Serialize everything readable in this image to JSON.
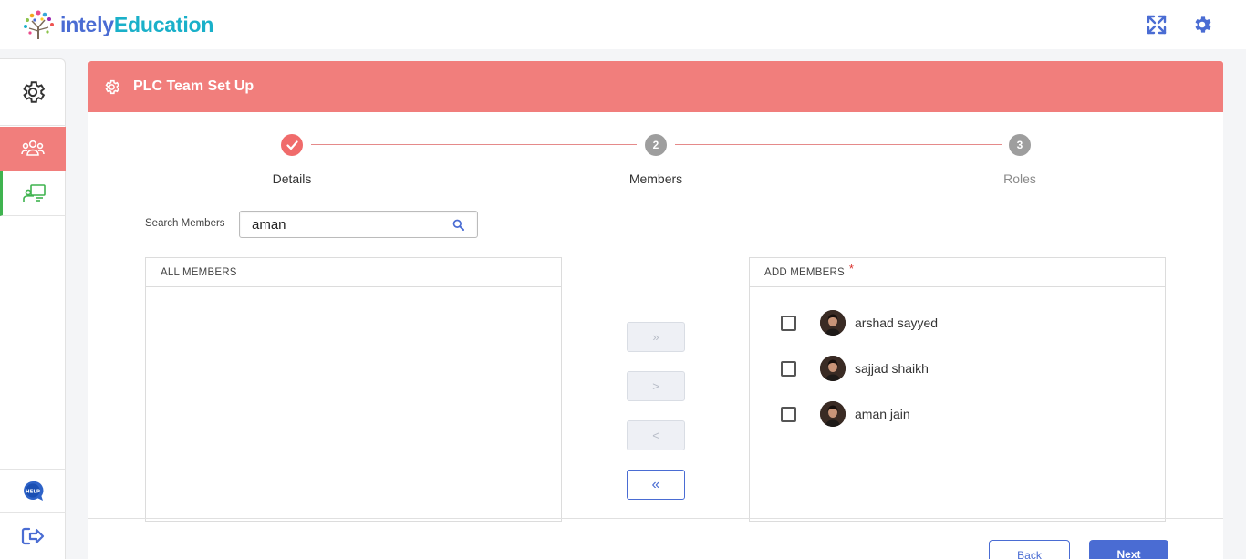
{
  "app": {
    "logo_text_1": "intely",
    "logo_text_2": "Education"
  },
  "topbar": {
    "fullscreen_icon": "expand-arrows-icon",
    "settings_icon": "gear-icon"
  },
  "sidebar": {
    "items": [
      {
        "name": "settings",
        "icon": "gear-outline-icon"
      },
      {
        "name": "team",
        "icon": "users-icon",
        "active": true
      },
      {
        "name": "classroom",
        "icon": "teacher-board-icon"
      },
      {
        "name": "help",
        "icon": "help-bubble-icon",
        "label": "HELP"
      },
      {
        "name": "logout",
        "icon": "logout-icon"
      }
    ]
  },
  "header": {
    "title": "PLC Team Set Up"
  },
  "stepper": {
    "steps": [
      {
        "label": "Details",
        "number": "1",
        "state": "done"
      },
      {
        "label": "Members",
        "number": "2",
        "state": "current"
      },
      {
        "label": "Roles",
        "number": "3",
        "state": "upcoming"
      }
    ]
  },
  "search": {
    "label": "Search Members",
    "value": "aman"
  },
  "all_members": {
    "title": "ALL MEMBERS",
    "items": []
  },
  "add_members": {
    "title": "ADD MEMBERS",
    "required_mark": "*",
    "items": [
      {
        "name": "arshad sayyed",
        "checked": false
      },
      {
        "name": "sajjad shaikh",
        "checked": false
      },
      {
        "name": "aman jain",
        "checked": false
      }
    ]
  },
  "transfer": {
    "move_all_right": "»",
    "move_right": ">",
    "move_left": "<",
    "move_all_left": "«"
  },
  "footer": {
    "back_label": "Back",
    "next_label": "Next"
  },
  "colors": {
    "accent_red": "#f17e7c",
    "primary_blue": "#4a6cd3",
    "done_step": "#f06b6b",
    "pending_step": "#9e9e9e",
    "sidebar_green": "#3fb34f"
  }
}
